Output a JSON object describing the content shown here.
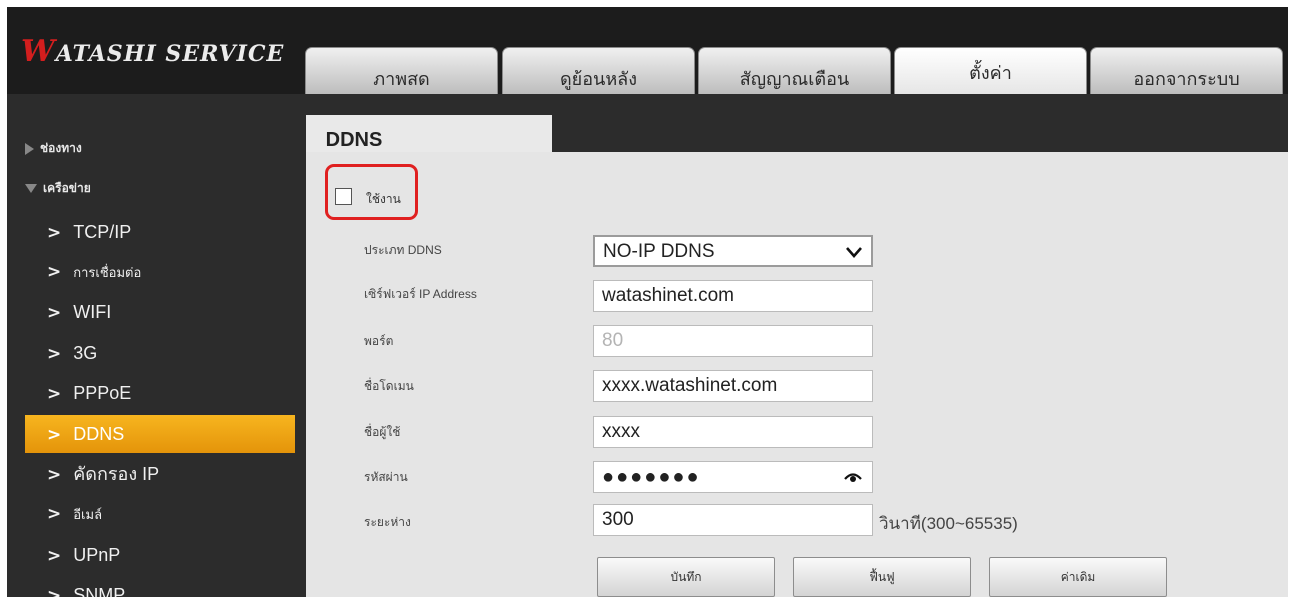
{
  "header": {
    "logo_first": "W",
    "logo_rest": "ATASHI SERVICE",
    "tabs": [
      {
        "label": "ภาพสด"
      },
      {
        "label": "ดูย้อนหลัง"
      },
      {
        "label": "สัญญาณเตือน"
      },
      {
        "label": "ตั้งค่า",
        "active": true
      },
      {
        "label": "ออกจากระบบ"
      }
    ]
  },
  "sidebar": {
    "sections": [
      {
        "label": "ช่องทาง",
        "expanded": false
      },
      {
        "label": "เครือข่าย",
        "expanded": true
      }
    ],
    "items": [
      {
        "label": "TCP/IP"
      },
      {
        "label": "การเชื่อมต่อ"
      },
      {
        "label": "WIFI"
      },
      {
        "label": "3G"
      },
      {
        "label": "PPPoE"
      },
      {
        "label": "DDNS",
        "active": true
      },
      {
        "label": "คัดกรอง IP"
      },
      {
        "label": "อีเมล์"
      },
      {
        "label": "UPnP"
      },
      {
        "label": "SNMP"
      }
    ],
    "chevron": ">"
  },
  "content": {
    "tab_title": "DDNS",
    "enable_label": "ใช้งาน",
    "enable_checked": false,
    "fields": {
      "ddns_type": {
        "label": "ประเภท DDNS",
        "value": "NO-IP DDNS"
      },
      "server_ip": {
        "label": "เซิร์ฟเวอร์ IP Address",
        "value": "watashinet.com"
      },
      "port": {
        "label": "พอร์ต",
        "value": "80"
      },
      "domain": {
        "label": "ชื่อโดเมน",
        "value": "xxxx.watashinet.com"
      },
      "username": {
        "label": "ชื่อผู้ใช้",
        "value": "xxxx"
      },
      "password": {
        "label": "รหัสผ่าน",
        "value": "●●●●●●●"
      },
      "interval": {
        "label": "ระยะห่าง",
        "value": "300",
        "unit": "วินาที(300~65535)"
      }
    },
    "buttons": {
      "save": "บันทึก",
      "refresh": "ฟื้นฟู",
      "default": "ค่าเดิม"
    }
  },
  "colors": {
    "accent_orange": "#f0a516",
    "highlight_red": "#e02020",
    "logo_red": "#d31e1e"
  },
  "icons": [
    "chevron-down-icon",
    "eye-icon",
    "triangle-right-icon",
    "triangle-down-icon"
  ]
}
